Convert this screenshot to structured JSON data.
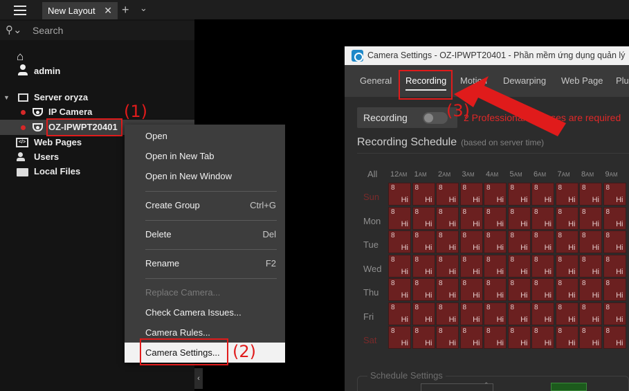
{
  "topbar": {
    "tab_label": "New Layout",
    "tab_close": "✕",
    "add": "+",
    "more": "⌄"
  },
  "left_panel": {
    "search_placeholder": "Search",
    "search_icon": "search-icon",
    "user": "admin",
    "tree": {
      "server": "Server oryza",
      "cameras": [
        "IP Camera",
        "OZ-IPWPT20401"
      ],
      "web_pages": "Web Pages",
      "users": "Users",
      "local_files": "Local Files"
    },
    "collapse": "‹"
  },
  "annotations": {
    "step1": "(1)",
    "step2": "(2)",
    "step3": "(3)",
    "annotation_color": "#e01b1b"
  },
  "context_menu": {
    "open": "Open",
    "open_new_tab": "Open in New Tab",
    "open_new_window": "Open in New Window",
    "create_group": "Create Group",
    "create_group_shortcut": "Ctrl+G",
    "delete": "Delete",
    "delete_shortcut": "Del",
    "rename": "Rename",
    "rename_shortcut": "F2",
    "replace_camera": "Replace Camera...",
    "check_issues": "Check Camera Issues...",
    "camera_rules": "Camera Rules...",
    "camera_settings": "Camera Settings..."
  },
  "camera_settings": {
    "title": "Camera Settings - OZ-IPWPT20401 - Phần mềm ứng dụng quản lý",
    "tabs": [
      "General",
      "Recording",
      "Motion",
      "Dewarping",
      "Web Page",
      "Plu"
    ],
    "active_tab": "Recording",
    "recording_label": "Recording",
    "warning": "2 Professional Licenses are required",
    "schedule_title": "Recording Schedule",
    "schedule_sub": "(based on server time)",
    "all_label": "All",
    "hours": [
      [
        "12",
        "AM"
      ],
      [
        "1",
        "AM"
      ],
      [
        "2",
        "AM"
      ],
      [
        "3",
        "AM"
      ],
      [
        "4",
        "AM"
      ],
      [
        "5",
        "AM"
      ],
      [
        "6",
        "AM"
      ],
      [
        "7",
        "AM"
      ],
      [
        "8",
        "AM"
      ],
      [
        "9",
        "AM"
      ]
    ],
    "days": [
      "Sun",
      "Mon",
      "Tue",
      "Wed",
      "Thu",
      "Fri",
      "Sat"
    ],
    "cell_value": "8",
    "cell_quality": "Hi",
    "schedule_settings": "Schedule Settings",
    "grid_color": "#6b2020"
  }
}
